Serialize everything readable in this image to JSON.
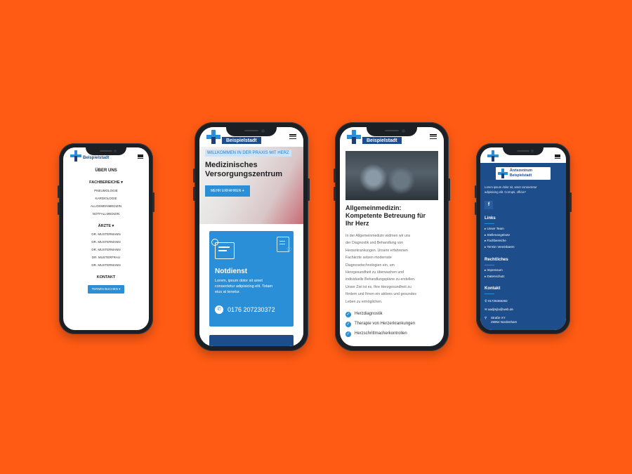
{
  "colors": {
    "background": "#ff5b14",
    "primary_blue": "#2a8fd6",
    "dark_blue": "#1d4d8a",
    "phone_frame": "#1c1f24"
  },
  "brand": {
    "city": "Beispielstadt"
  },
  "phone1": {
    "menu": {
      "ueber_uns": "ÜBER UNS",
      "fachbereiche": "FACHBEREICHE",
      "fachbereiche_items": [
        "PNEUMOLOGIE",
        "KARDIOLOGIE",
        "ALLGEMEINMEDIZIN",
        "NOTFALLMEDIZIN"
      ],
      "aerzte": "ÄRZTE",
      "aerzte_items": [
        "DR. MUSTERMANN",
        "DR. MUSTERMANN",
        "DR. MUSTERMANN",
        "DR. MUSTERFRAU",
        "DR. MUSTERMANN"
      ],
      "kontakt": "KONTAKT",
      "termin_button": "TERMIN BUCHEN"
    }
  },
  "phone2": {
    "tagline": "WILLKOMMEN IN DER PRAXIS MIT HERZ",
    "headline_1": "Medizinisches",
    "headline_2": "Versorgungszentrum",
    "cta": "MEHR ERFAHREN",
    "card": {
      "title": "Notdienst",
      "text_1": "Lorem, ipsum dolor sit amet",
      "text_2": "consectetur adipisicing elit. Totam",
      "text_3": "eius at tenetur.",
      "phone": "0176 207230372"
    }
  },
  "phone3": {
    "title_1": "Allgemeinmedizin:",
    "title_2": "Kompetente Betreuung für",
    "title_3": "Ihr Herz",
    "body": [
      "In der Allgemeinmedizin widmen wir uns",
      "der Diagnostik und Behandlung von",
      "Herzerkrankungen. Unsere erfahrenen",
      "Fachärzte setzen modernste",
      "Diagnosetechnologien ein, um",
      "Herzgesundheit zu überwachen und",
      "individuelle Behandlungspläne zu erstellen.",
      "Unser Ziel ist es, Ihre Herzgesundheit zu",
      "fördern und Ihnen ein aktives und gesundes",
      "Leben zu ermöglichen."
    ],
    "checklist": [
      "Herzdiagnostik",
      "Therapie von Herzerkrankungen",
      "Herzschrittmacherkontrollen"
    ]
  },
  "phone4": {
    "logo_line_1": "Ärztezentrum",
    "logo_line_2": "Beispielstadt",
    "intro_1": "Lorem ipsum dolor sit, amet consectetur",
    "intro_2": "adipisicing elit. Corrupti, officia?",
    "facebook_icon_glyph": "f",
    "links_heading": "Links",
    "links": [
      "Unser Team",
      "Stellenangebote",
      "Fachbereiche",
      "Termin Vereinbaren"
    ],
    "rechtliches_heading": "Rechtliches",
    "rechtliches": [
      "Impressum",
      "Datenschutz"
    ],
    "kontakt_heading": "Kontakt",
    "phone": "01726366282",
    "email": "aadjmjla@web.de",
    "address_1": "Straße XY",
    "address_2": "26954 Nordenham"
  }
}
